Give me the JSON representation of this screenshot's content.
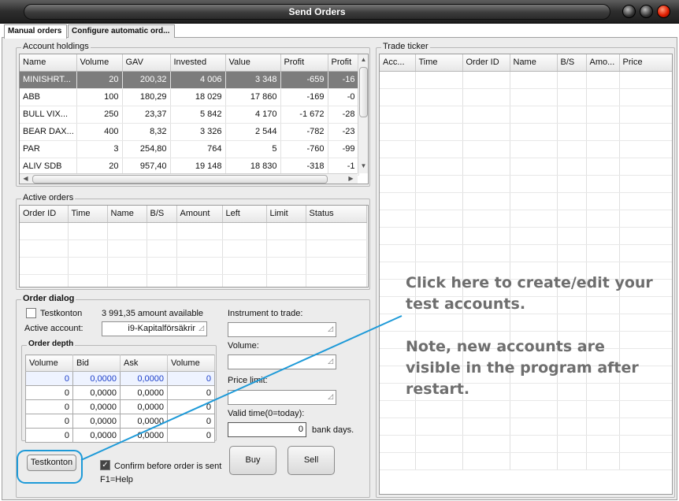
{
  "window": {
    "title": "Send Orders"
  },
  "tabs": [
    {
      "label": "Manual orders",
      "active": true
    },
    {
      "label": "Configure automatic ord...",
      "active": false
    }
  ],
  "holdings": {
    "title": "Account holdings",
    "columns": [
      "Name",
      "Volume",
      "GAV",
      "Invested",
      "Value",
      "Profit",
      "Profit"
    ],
    "rows": [
      [
        "MINISHRT...",
        "20",
        "200,32",
        "4 006",
        "3 348",
        "-659",
        "-16"
      ],
      [
        "ABB",
        "100",
        "180,29",
        "18 029",
        "17 860",
        "-169",
        "-0"
      ],
      [
        "BULL VIX...",
        "250",
        "23,37",
        "5 842",
        "4 170",
        "-1 672",
        "-28"
      ],
      [
        "BEAR DAX...",
        "400",
        "8,32",
        "3 326",
        "2 544",
        "-782",
        "-23"
      ],
      [
        "PAR",
        "3",
        "254,80",
        "764",
        "5",
        "-760",
        "-99"
      ],
      [
        "ALIV SDB",
        "20",
        "957,40",
        "19 148",
        "18 830",
        "-318",
        "-1"
      ]
    ]
  },
  "active_orders": {
    "title": "Active orders",
    "columns": [
      "Order ID",
      "Time",
      "Name",
      "B/S",
      "Amount",
      "Left",
      "Limit",
      "Status"
    ]
  },
  "order_dialog": {
    "title": "Order dialog",
    "testkonton_label": "Testkonton",
    "amount_available": "3 991,35 amount available",
    "active_account_label": "Active account:",
    "active_account_value": "i9-Kapitalförsäkrir",
    "instrument_label": "Instrument to trade:",
    "volume_label": "Volume:",
    "price_limit_label": "Price limit:",
    "valid_time_label": "Valid time(0=today):",
    "valid_time_value": "0",
    "bank_days": "bank days.",
    "confirm_label": "Confirm before order is sent",
    "help_label": "F1=Help",
    "testkonton_button": "Testkonton",
    "buy_button": "Buy",
    "sell_button": "Sell"
  },
  "order_depth": {
    "title": "Order depth",
    "columns": [
      "Volume",
      "Bid",
      "Ask",
      "Volume"
    ],
    "rows": [
      [
        "0",
        "0,0000",
        "0,0000",
        "0"
      ],
      [
        "0",
        "0,0000",
        "0,0000",
        "0"
      ],
      [
        "0",
        "0,0000",
        "0,0000",
        "0"
      ],
      [
        "0",
        "0,0000",
        "0,0000",
        "0"
      ],
      [
        "0",
        "0,0000",
        "0,0000",
        "0"
      ]
    ]
  },
  "trade_ticker": {
    "title": "Trade ticker",
    "columns": [
      "Acc...",
      "Time",
      "Order ID",
      "Name",
      "B/S",
      "Amo...",
      "Price"
    ]
  },
  "annotation": {
    "line1": "Click here to create/edit your",
    "line2": "test accounts.",
    "line3": "Note, new accounts are",
    "line4": "visible in the program after",
    "line5": "restart.",
    "color": "#1e9ad8"
  }
}
